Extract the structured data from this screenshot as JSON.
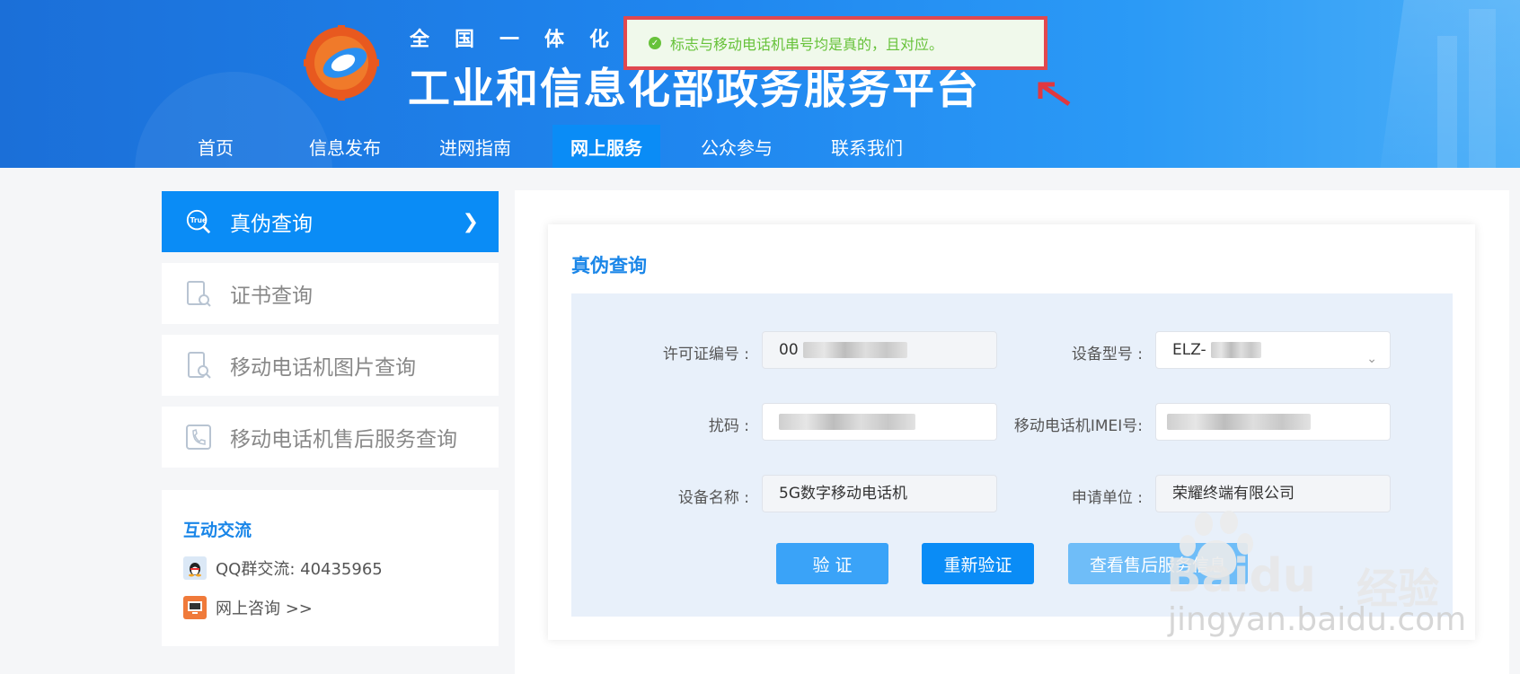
{
  "header": {
    "title_top": "全国一体化",
    "title_main": "工业和信息化部政务服务平台"
  },
  "nav": {
    "items": [
      "首页",
      "信息发布",
      "进网指南",
      "网上服务",
      "公众参与",
      "联系我们"
    ],
    "active": "网上服务"
  },
  "toast": {
    "message": "标志与移动电话机串号均是真的，且对应。"
  },
  "sidebar": {
    "items": [
      {
        "label": "真伪查询",
        "icon": "true-search-icon",
        "active": true
      },
      {
        "label": "证书查询",
        "icon": "certificate-search-icon",
        "active": false
      },
      {
        "label": "移动电话机图片查询",
        "icon": "phone-image-search-icon",
        "active": false
      },
      {
        "label": "移动电话机售后服务查询",
        "icon": "phone-service-icon",
        "active": false
      }
    ],
    "interact": {
      "title": "互动交流",
      "qq": "QQ群交流: 40435965",
      "online": "网上咨询 >>"
    }
  },
  "main": {
    "title": "真伪查询",
    "fields": {
      "license_label": "许可证编号 :",
      "license_value": "00",
      "model_label": "设备型号 :",
      "model_value": "ELZ-",
      "code_label": "扰码 :",
      "imei_label": "移动电话机IMEI号:",
      "name_label": "设备名称 :",
      "name_value": "5G数字移动电话机",
      "applicant_label": "申请单位 :",
      "applicant_value": "荣耀终端有限公司"
    },
    "buttons": {
      "verify": "验 证",
      "reverify": "重新验证",
      "service": "查看售后服务信息"
    }
  },
  "watermark": {
    "brand": "Baidu",
    "cn": "经验",
    "url": "jingyan.baidu.com"
  },
  "colors": {
    "primary": "#0a8cf6",
    "success": "#67c23a",
    "highlight_border": "#e0484f"
  }
}
